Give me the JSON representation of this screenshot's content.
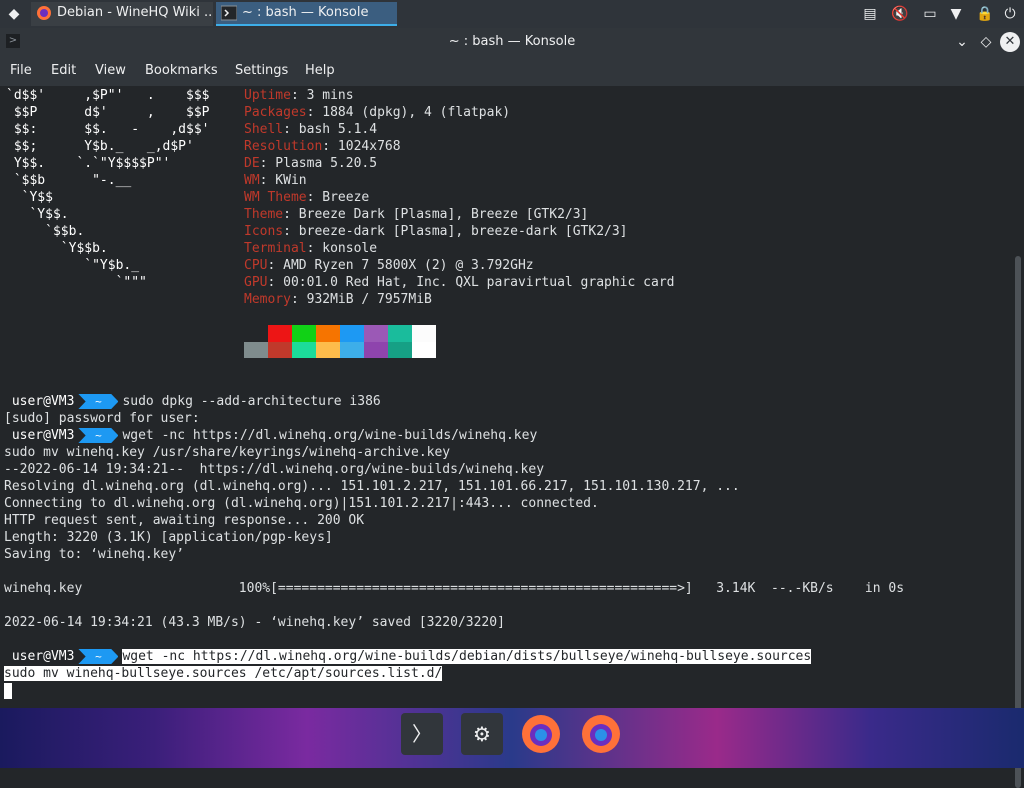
{
  "panel": {
    "launcher_icon": "application-launcher-icon",
    "tasks": [
      {
        "label": "Debian - WineHQ Wiki ...",
        "icon": "firefox-icon",
        "active": false
      },
      {
        "label": "~ : bash — Konsole",
        "icon": "terminal-icon",
        "active": true
      }
    ],
    "tray": [
      "clipboard-icon",
      "volume-muted-icon",
      "network-icon",
      "expand-tray-icon",
      "lock-icon",
      "power-icon"
    ]
  },
  "window": {
    "title": "~ : bash — Konsole",
    "buttons": [
      "minimize",
      "keep-above",
      "close"
    ]
  },
  "menubar": {
    "items": [
      "File",
      "Edit",
      "View",
      "Bookmarks",
      "Settings",
      "Help"
    ]
  },
  "neofetch": {
    "logo": [
      "`d$$'     ,$P\"'   .    $$$",
      " $$P      d$'     ,    $$P",
      " $$:      $$.   -    ,d$$'",
      " $$;      Y$b._   _,d$P'",
      " Y$$.    `.`\"Y$$$$P\"'",
      " `$$b      \"-.__",
      "  `Y$$",
      "   `Y$$.",
      "     `$$b.",
      "       `Y$$b.",
      "          `\"Y$b._",
      "              `\"\"\""
    ],
    "info": [
      {
        "key": "Uptime",
        "value": "3 mins"
      },
      {
        "key": "Packages",
        "value": "1884 (dpkg), 4 (flatpak)"
      },
      {
        "key": "Shell",
        "value": "bash 5.1.4"
      },
      {
        "key": "Resolution",
        "value": "1024x768"
      },
      {
        "key": "DE",
        "value": "Plasma 5.20.5"
      },
      {
        "key": "WM",
        "value": "KWin"
      },
      {
        "key": "WM Theme",
        "value": "Breeze"
      },
      {
        "key": "Theme",
        "value": "Breeze Dark [Plasma], Breeze [GTK2/3]"
      },
      {
        "key": "Icons",
        "value": "breeze-dark [Plasma], breeze-dark [GTK2/3]"
      },
      {
        "key": "Terminal",
        "value": "konsole"
      },
      {
        "key": "CPU",
        "value": "AMD Ryzen 7 5800X (2) @ 3.792GHz"
      },
      {
        "key": "GPU",
        "value": "00:01.0 Red Hat, Inc. QXL paravirtual graphic card"
      },
      {
        "key": "Memory",
        "value": "932MiB / 7957MiB"
      }
    ],
    "colors_top": [
      "#232629",
      "#ed1515",
      "#11d116",
      "#f67400",
      "#1d99f3",
      "#9b59b6",
      "#1abc9c",
      "#fcfcfc"
    ],
    "colors_bottom": [
      "#7f8c8d",
      "#c0392b",
      "#1cdc9a",
      "#fdbc4b",
      "#3daee9",
      "#8e44ad",
      "#16a085",
      "#ffffff"
    ]
  },
  "prompt": {
    "user": "user@VM3",
    "dir": "~"
  },
  "output": [
    {
      "type": "prompt",
      "cmd": "sudo dpkg --add-architecture i386"
    },
    {
      "type": "text",
      "text": "[sudo] password for user:"
    },
    {
      "type": "prompt",
      "cmd": "wget -nc https://dl.winehq.org/wine-builds/winehq.key"
    },
    {
      "type": "text",
      "text": "sudo mv winehq.key /usr/share/keyrings/winehq-archive.key"
    },
    {
      "type": "text",
      "text": "--2022-06-14 19:34:21--  https://dl.winehq.org/wine-builds/winehq.key"
    },
    {
      "type": "text",
      "text": "Resolving dl.winehq.org (dl.winehq.org)... 151.101.2.217, 151.101.66.217, 151.101.130.217, ..."
    },
    {
      "type": "text",
      "text": "Connecting to dl.winehq.org (dl.winehq.org)|151.101.2.217|:443... connected."
    },
    {
      "type": "text",
      "text": "HTTP request sent, awaiting response... 200 OK"
    },
    {
      "type": "text",
      "text": "Length: 3220 (3.1K) [application/pgp-keys]"
    },
    {
      "type": "text",
      "text": "Saving to: ‘winehq.key’"
    },
    {
      "type": "text",
      "text": ""
    },
    {
      "type": "text",
      "text": "winehq.key                    100%[===================================================>]   3.14K  --.-KB/s    in 0s"
    },
    {
      "type": "text",
      "text": ""
    },
    {
      "type": "text",
      "text": "2022-06-14 19:34:21 (43.3 MB/s) - ‘winehq.key’ saved [3220/3220]"
    },
    {
      "type": "text",
      "text": ""
    },
    {
      "type": "prompt_sel",
      "cmd": "wget -nc https://dl.winehq.org/wine-builds/debian/dists/bullseye/winehq-bullseye.sources"
    },
    {
      "type": "text_sel",
      "text": "sudo mv winehq-bullseye.sources /etc/apt/sources.list.d/"
    }
  ],
  "dock": {
    "items": [
      "terminal-icon",
      "settings-icon",
      "firefox-icon",
      "firefox-icon"
    ]
  }
}
